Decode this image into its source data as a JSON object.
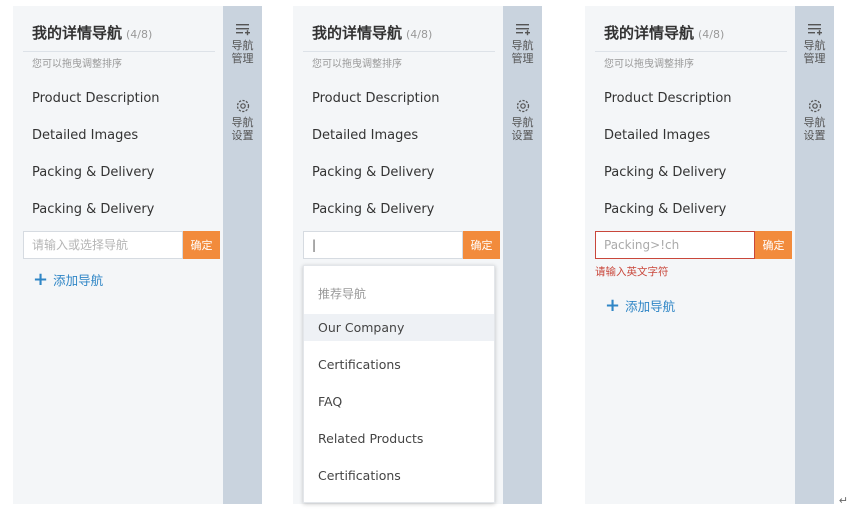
{
  "panels": [
    {
      "title": "我的详情导航",
      "count": "(4/8)",
      "hint": "您可以拖曳调整排序",
      "items": [
        "Product Description",
        "Detailed Images",
        "Packing & Delivery",
        "Packing & Delivery"
      ],
      "input_value": "",
      "input_placeholder": "请输入或选择导航",
      "confirm_label": "确定",
      "add_label": "添加导航"
    },
    {
      "title": "我的详情导航",
      "count": "(4/8)",
      "hint": "您可以拖曳调整排序",
      "items": [
        "Product Description",
        "Detailed Images",
        "Packing & Delivery",
        "Packing & Delivery"
      ],
      "input_value": "|",
      "confirm_label": "确定",
      "dropdown": {
        "header": "推荐导航",
        "options": [
          "Our Company",
          "Certifications",
          "FAQ",
          "Related Products",
          "Certifications"
        ]
      }
    },
    {
      "title": "我的详情导航",
      "count": "(4/8)",
      "hint": "您可以拖曳调整排序",
      "items": [
        "Product Description",
        "Detailed Images",
        "Packing & Delivery",
        "Packing & Delivery"
      ],
      "input_value": "Packing>!ch",
      "confirm_label": "确定",
      "error_text": "请输入英文字符",
      "add_label": "添加导航"
    }
  ],
  "rail": {
    "manage_line1": "导航",
    "manage_line2": "管理",
    "settings_line1": "导航",
    "settings_line2": "设置",
    "manage_icon": "list-add-icon",
    "settings_icon": "gear-icon"
  },
  "colors": {
    "accent_orange": "#f28b3c",
    "link_blue": "#2f86c6",
    "error_red": "#c9473b",
    "rail_bg": "#c9d3de",
    "panel_bg": "#f4f6f8"
  },
  "corner_mark": "↵"
}
